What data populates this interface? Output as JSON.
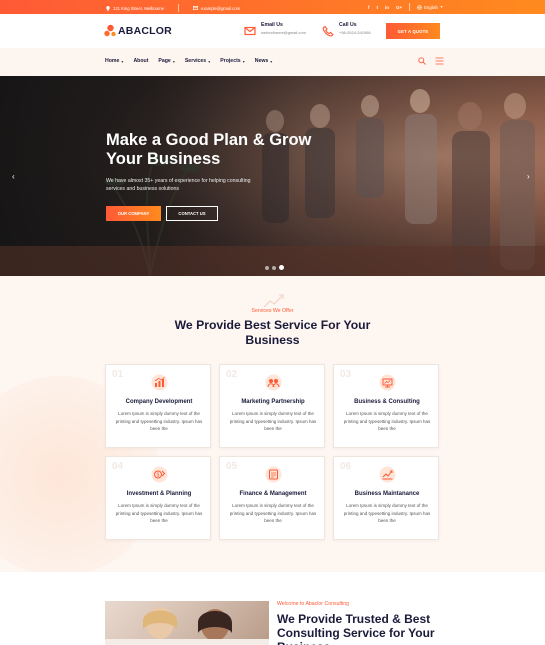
{
  "topbar": {
    "address": "121 King Street, Melbourne",
    "email": "example@gmail.com",
    "social": [
      "f",
      "t",
      "in",
      "G+"
    ],
    "language": "English"
  },
  "header": {
    "logo": "ABACLOR",
    "email_label": "Email Us",
    "email_value": "webextheme@gmail.com",
    "call_label": "Call Us",
    "call_value": "+98-0524-541986",
    "quote_button": "GET A QUOTE"
  },
  "nav": {
    "items": [
      {
        "label": "Home",
        "dropdown": true
      },
      {
        "label": "About",
        "dropdown": false
      },
      {
        "label": "Page",
        "dropdown": true
      },
      {
        "label": "Services",
        "dropdown": true
      },
      {
        "label": "Projects",
        "dropdown": true
      },
      {
        "label": "News",
        "dropdown": true
      }
    ]
  },
  "hero": {
    "title": "Make a Good Plan & Grow Your Business",
    "description": "We have almost 35+ years of experience for helping consulting services and business solutions",
    "primary_button": "OUR COMPANY",
    "secondary_button": "CONTACT US"
  },
  "services": {
    "eyebrow": "Services We Offer",
    "heading": "We Provide Best Service For Your Business",
    "cards": [
      {
        "num": "01",
        "title": "Company Development",
        "icon": "company-development-icon",
        "desc": "Lorem Ipsum is simply dummy text of the printing and typesetting industry. Ipsum has been the"
      },
      {
        "num": "02",
        "title": "Marketing Partnership",
        "icon": "marketing-partnership-icon",
        "desc": "Lorem Ipsum is simply dummy text of the printing and typesetting industry. Ipsum has been the"
      },
      {
        "num": "03",
        "title": "Business & Consulting",
        "icon": "business-consulting-icon",
        "desc": "Lorem Ipsum is simply dummy text of the printing and typesetting industry. Ipsum has been the"
      },
      {
        "num": "04",
        "title": "Investment & Planning",
        "icon": "investment-planning-icon",
        "desc": "Lorem Ipsum is simply dummy text of the printing and typesetting industry. Ipsum has been the"
      },
      {
        "num": "05",
        "title": "Finance & Management",
        "icon": "finance-management-icon",
        "desc": "Lorem Ipsum is simply dummy text of the printing and typesetting industry. Ipsum has been the"
      },
      {
        "num": "06",
        "title": "Business Maintanance",
        "icon": "business-maintanance-icon",
        "desc": "Lorem Ipsum is simply dummy text of the printing and typesetting industry. Ipsum has been the"
      }
    ]
  },
  "about": {
    "eyebrow": "Welcome to Abaclor Consulting",
    "heading": "We Provide Trusted & Best Consulting Service for Your Business"
  },
  "colors": {
    "accent": "#ff5a36",
    "accent2": "#ff8a1e",
    "dark": "#1a1a3a"
  }
}
